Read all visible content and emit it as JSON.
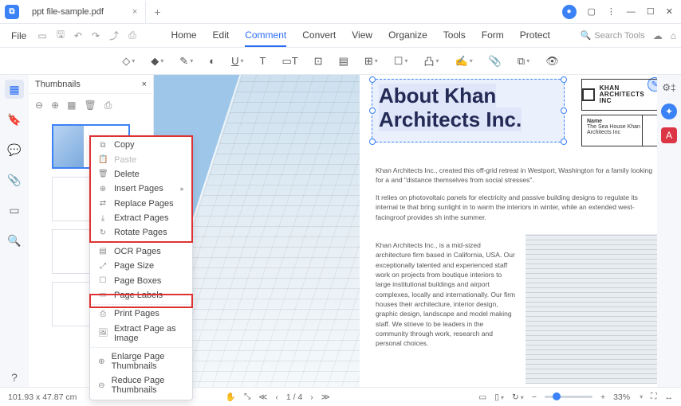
{
  "titlebar": {
    "tab_name": "ppt file-sample.pdf"
  },
  "menubar": {
    "file": "File",
    "tabs": [
      "Home",
      "Edit",
      "Comment",
      "Convert",
      "View",
      "Organize",
      "Tools",
      "Form",
      "Protect"
    ],
    "active": "Comment",
    "search_placeholder": "Search Tools"
  },
  "thumbnails": {
    "title": "Thumbnails"
  },
  "context_menu": {
    "copy": "Copy",
    "paste": "Paste",
    "delete": "Delete",
    "insert_pages": "Insert Pages",
    "replace_pages": "Replace Pages",
    "extract_pages": "Extract Pages",
    "rotate_pages": "Rotate Pages",
    "ocr_pages": "OCR Pages",
    "page_size": "Page Size",
    "page_boxes": "Page Boxes",
    "page_labels": "Page Labels",
    "print_pages": "Print Pages",
    "extract_image": "Extract Page as Image",
    "enlarge_thumb": "Enlarge Page Thumbnails",
    "reduce_thumb": "Reduce Page Thumbnails"
  },
  "document": {
    "title_text": "About Khan Architects Inc.",
    "logo_text": "KHAN\nARCHITECTS INC",
    "name_label": "Name",
    "name_value": "The Sea House Khan Architects Inc",
    "para1": "Khan Architects Inc., created this off-grid retreat in Westport, Washington for a family looking for a and \"distance themselves from social stresses\".",
    "para2": "It relies on photovoltaic panels for electricity and passive building designs to regulate its internal te that bring sunlight in to warm the interiors in winter, while an extended west-facingroof provides sh inthe summer.",
    "col_text": "Khan Architects Inc., is a mid-sized architecture firm based in California, USA. Our exceptionally talented and experienced staff work on projects from boutique interiors to large institutional buildings and airport complexes, locally and internationally. Our firm houses their architecture, interior design, graphic design, landscape and model making staff. We strieve to be leaders in the community through work, research and personal choices."
  },
  "status": {
    "coords": "101.93 x 47.87 cm",
    "page_current": "1",
    "page_total": "4",
    "zoom": "33%"
  }
}
